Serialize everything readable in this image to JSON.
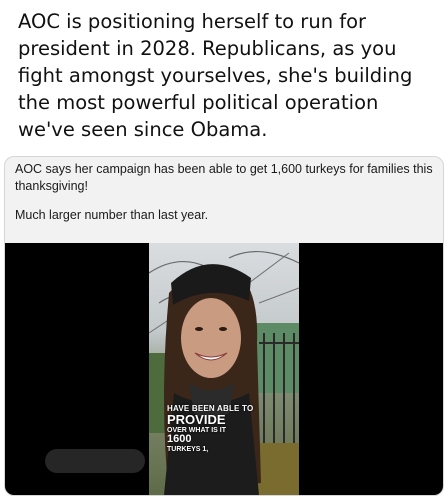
{
  "headline": "AOC is positioning herself to run for president in 2028.  Republicans, as you fight amongst yourselves, she's building the most powerful political operation we've seen since Obama.",
  "tweet": {
    "paragraph_1": "AOC says her campaign has been able to get 1,600 turkeys for families this thanksgiving!",
    "paragraph_2": "Much larger number than last year."
  },
  "video": {
    "caption_line_1": "HAVE BEEN ABLE TO",
    "caption_line_2": "PROVIDE",
    "caption_line_3": "OVER WHAT IS IT",
    "caption_line_4": "1600",
    "caption_line_5": "TURKEYS 1,"
  }
}
